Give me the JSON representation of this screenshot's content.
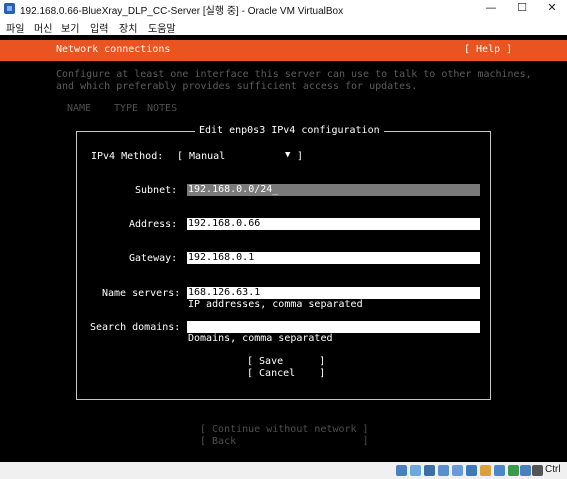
{
  "window": {
    "title": "192.168.0.66-BlueXray_DLP_CC-Server [실행 중] - Oracle VM VirtualBox",
    "controls": {
      "minimize": "—",
      "maximize": "☐",
      "close": "✕"
    }
  },
  "menu": {
    "items": [
      "파일",
      "머신",
      "보기",
      "입력",
      "장치",
      "도움말"
    ]
  },
  "installer": {
    "header_title": "Network connections",
    "help": "[ Help ]",
    "description_lines": [
      "Configure at least one interface this server can use to talk to other machines,",
      "and which preferably provides sufficient access for updates."
    ],
    "columns": [
      "NAME",
      "TYPE",
      "NOTES"
    ],
    "continue_label": "[ Continue without network ]",
    "back_label": "[ Back                     ]"
  },
  "dialog": {
    "title": "Edit enp0s3 IPv4 configuration",
    "ipv4_method_label": "IPv4 Method:",
    "ipv4_method_value": "[ Manual",
    "ipv4_method_close": "]",
    "subnet_label": "Subnet:",
    "subnet_value": "192.168.0.0/24_",
    "address_label": "Address:",
    "address_value": "192.168.0.66",
    "gateway_label": "Gateway:",
    "gateway_value": "192.168.0.1",
    "nameservers_label": "Name servers:",
    "nameservers_value": "168.126.63.1",
    "nameservers_hint": "IP addresses, comma separated",
    "search_label": "Search domains:",
    "search_value": "",
    "search_hint": "Domains, comma separated",
    "save_label": "[ Save      ]",
    "cancel_label": "[ Cancel    ]"
  },
  "colors": {
    "accent": "#e95420",
    "screen_bg": "#000000",
    "focused_field": "#7a7a7a"
  },
  "statusbar": {
    "icons": [
      "hard-disk-icon",
      "optical-drive-icon",
      "audio-icon",
      "network-icon",
      "usb-icon",
      "shared-folder-icon",
      "display-icon",
      "video-capture-icon",
      "cpu-icon",
      "mouse-integration-icon",
      "keyboard-icon"
    ],
    "host_key": "Ctrl"
  }
}
